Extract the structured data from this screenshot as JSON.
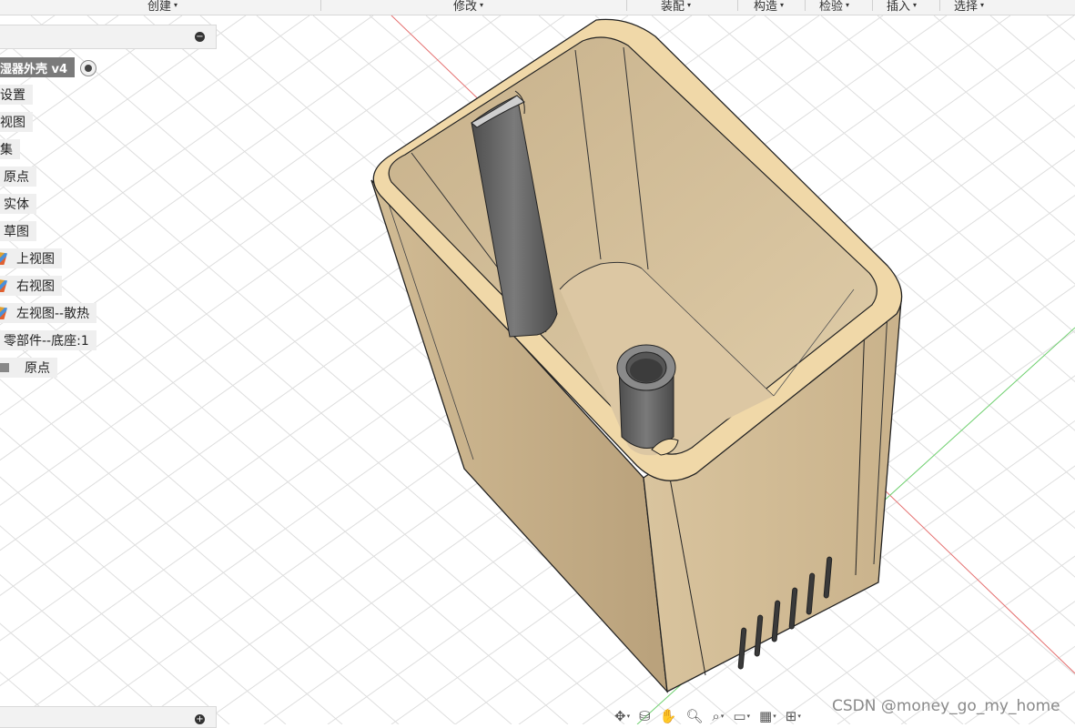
{
  "menubar": {
    "items": [
      {
        "label": "创建",
        "name": "menu-create"
      },
      {
        "label": "修改",
        "name": "menu-modify"
      },
      {
        "label": "装配",
        "name": "menu-assemble"
      },
      {
        "label": "构造",
        "name": "menu-construct"
      },
      {
        "label": "检验",
        "name": "menu-inspect"
      },
      {
        "label": "插入",
        "name": "menu-insert"
      },
      {
        "label": "选择",
        "name": "menu-select"
      }
    ]
  },
  "browser": {
    "root_label": "湿器外壳 v4",
    "nodes": [
      {
        "label": "设置"
      },
      {
        "label": "视图"
      },
      {
        "label": "集"
      },
      {
        "label": "原点"
      },
      {
        "label": "实体"
      },
      {
        "label": "草图"
      },
      {
        "label": "上视图"
      },
      {
        "label": "右视图"
      },
      {
        "label": "左视图--散热"
      },
      {
        "label": "零部件--底座:1"
      },
      {
        "label": "原点"
      }
    ]
  },
  "colors": {
    "body": "#c7b08a",
    "rim": "#f0d8a8",
    "floor": "#dcc7a3",
    "post": "#6b6b6b",
    "grid": "#dcdcdc",
    "axis_red": "#e05050",
    "axis_green": "#59c859"
  },
  "navbar": {
    "icons": [
      "orbit-icon",
      "look-at-icon",
      "pan-icon",
      "zoom-icon",
      "fit-icon",
      "display-settings-icon",
      "grid-settings-icon",
      "viewports-icon"
    ]
  },
  "watermark": "CSDN @money_go_my_home"
}
